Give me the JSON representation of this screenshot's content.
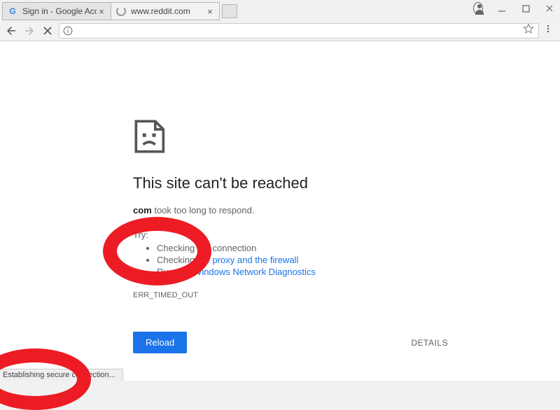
{
  "window": {
    "profile": "profile"
  },
  "tabs": [
    {
      "title": "Sign in - Google Accounts",
      "favicon": "google"
    },
    {
      "title": "www.reddit.com",
      "favicon": "spinner"
    }
  ],
  "toolbar": {
    "url": ""
  },
  "error": {
    "title": "This site can't be reached",
    "subtitle_domain": "com",
    "subtitle_rest": " took too long to respond.",
    "try_label": "Try:",
    "checks": {
      "connection": "Checking the connection",
      "proxy_prefix": "Checking ",
      "proxy_link": "the proxy and the firewall",
      "diag_prefix": "Running ",
      "diag_link": "Windows Network Diagnostics"
    },
    "code": "ERR_TIMED_OUT",
    "reload": "Reload",
    "details": "DETAILS"
  },
  "status": "Establishing secure connection..."
}
